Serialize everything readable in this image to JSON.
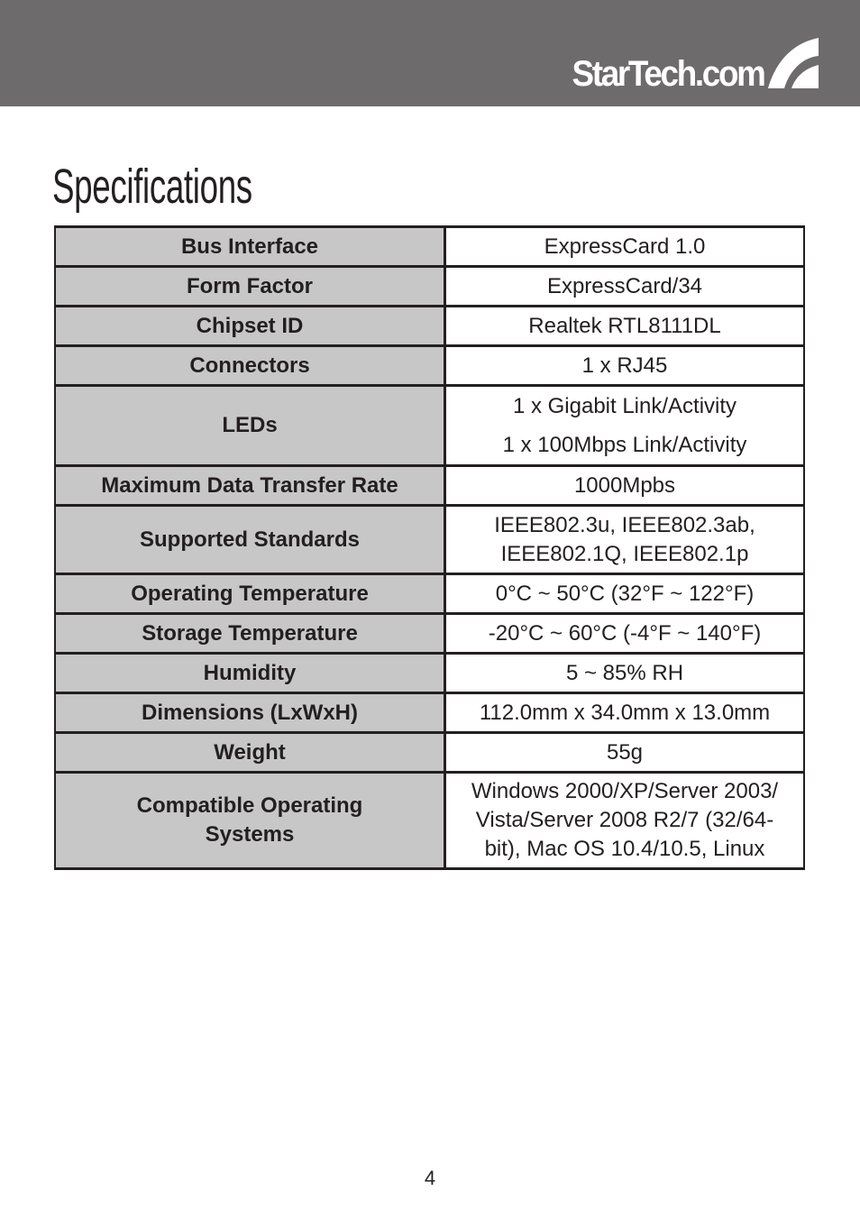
{
  "header": {
    "brand": "StarTech.com",
    "band_color": "#6d6b6c",
    "logo_icon": "startech-swoosh-icon"
  },
  "page_title": "Specifications",
  "specs": [
    {
      "label": "Bus Interface",
      "value_lines": [
        "ExpressCard 1.0"
      ]
    },
    {
      "label": "Form Factor",
      "value_lines": [
        "ExpressCard/34"
      ]
    },
    {
      "label": "Chipset ID",
      "value_lines": [
        "Realtek RTL8111DL"
      ]
    },
    {
      "label": "Connectors",
      "value_lines": [
        "1 x RJ45"
      ]
    },
    {
      "label": "LEDs",
      "value_lines": [
        "1 x Gigabit Link/Activity",
        "1 x 100Mbps Link/Activity"
      ]
    },
    {
      "label": "Maximum Data Transfer Rate",
      "value_lines": [
        "1000Mpbs"
      ]
    },
    {
      "label": "Supported Standards",
      "value_lines": [
        "IEEE802.3u, IEEE802.3ab,",
        "IEEE802.1Q, IEEE802.1p"
      ]
    },
    {
      "label": "Operating Temperature",
      "value_lines": [
        "0°C ~ 50°C (32°F ~ 122°F)"
      ]
    },
    {
      "label": "Storage Temperature",
      "value_lines": [
        "-20°C ~ 60°C (-4°F ~ 140°F)"
      ]
    },
    {
      "label": "Humidity",
      "value_lines": [
        "5 ~ 85% RH"
      ]
    },
    {
      "label": "Dimensions (LxWxH)",
      "value_lines": [
        "112.0mm x 34.0mm x 13.0mm"
      ]
    },
    {
      "label": "Weight",
      "value_lines": [
        "55g"
      ]
    },
    {
      "label_lines": [
        "Compatible Operating",
        "Systems"
      ],
      "value_lines": [
        "Windows 2000/XP/Server 2003/",
        "Vista/Server 2008 R2/7 (32/64-",
        "bit), Mac OS 10.4/10.5, Linux"
      ]
    }
  ],
  "colors": {
    "label_cell_bg": "#c7c7c7",
    "border": "#231f20",
    "text": "#231f20"
  },
  "page_number": "4"
}
